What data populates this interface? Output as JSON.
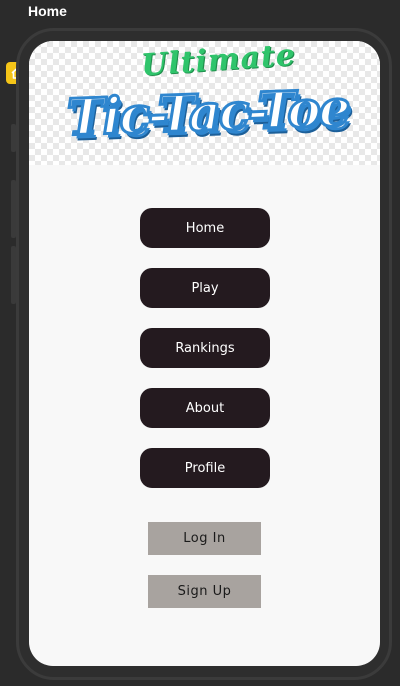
{
  "editor": {
    "page_title": "Home"
  },
  "logo": {
    "line1": "Ultimate",
    "line2": "Tic-Tac-Toe"
  },
  "nav": {
    "items": [
      {
        "label": "Home"
      },
      {
        "label": "Play"
      },
      {
        "label": "Rankings"
      },
      {
        "label": "About"
      },
      {
        "label": "Profile"
      }
    ]
  },
  "auth": {
    "login_label": "Log In",
    "signup_label": "Sign Up"
  },
  "colors": {
    "nav_button_bg": "#241a1f",
    "auth_button_bg": "#a8a39f",
    "logo_green": "#2fc46b",
    "logo_blue": "#2f86cf",
    "home_marker": "#f5c518"
  },
  "icons": {
    "home_marker": "home-icon"
  }
}
